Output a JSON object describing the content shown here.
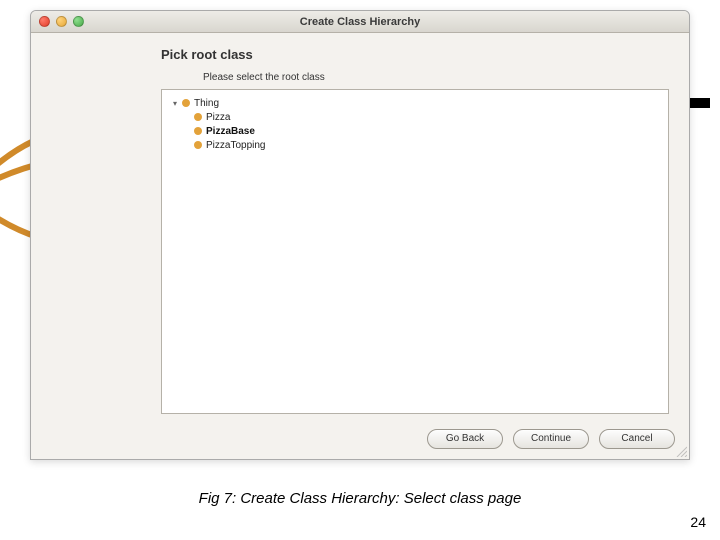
{
  "window": {
    "title": "Create Class Hierarchy",
    "heading": "Pick root class",
    "instruction": "Please select the root class"
  },
  "tree": {
    "root": "Thing",
    "children": [
      "Pizza",
      "PizzaBase",
      "PizzaTopping"
    ],
    "selected": "PizzaBase"
  },
  "buttons": {
    "go_back": "Go Back",
    "continue": "Continue",
    "cancel": "Cancel"
  },
  "caption": "Fig 7: Create Class Hierarchy: Select class page",
  "page_number": "24"
}
